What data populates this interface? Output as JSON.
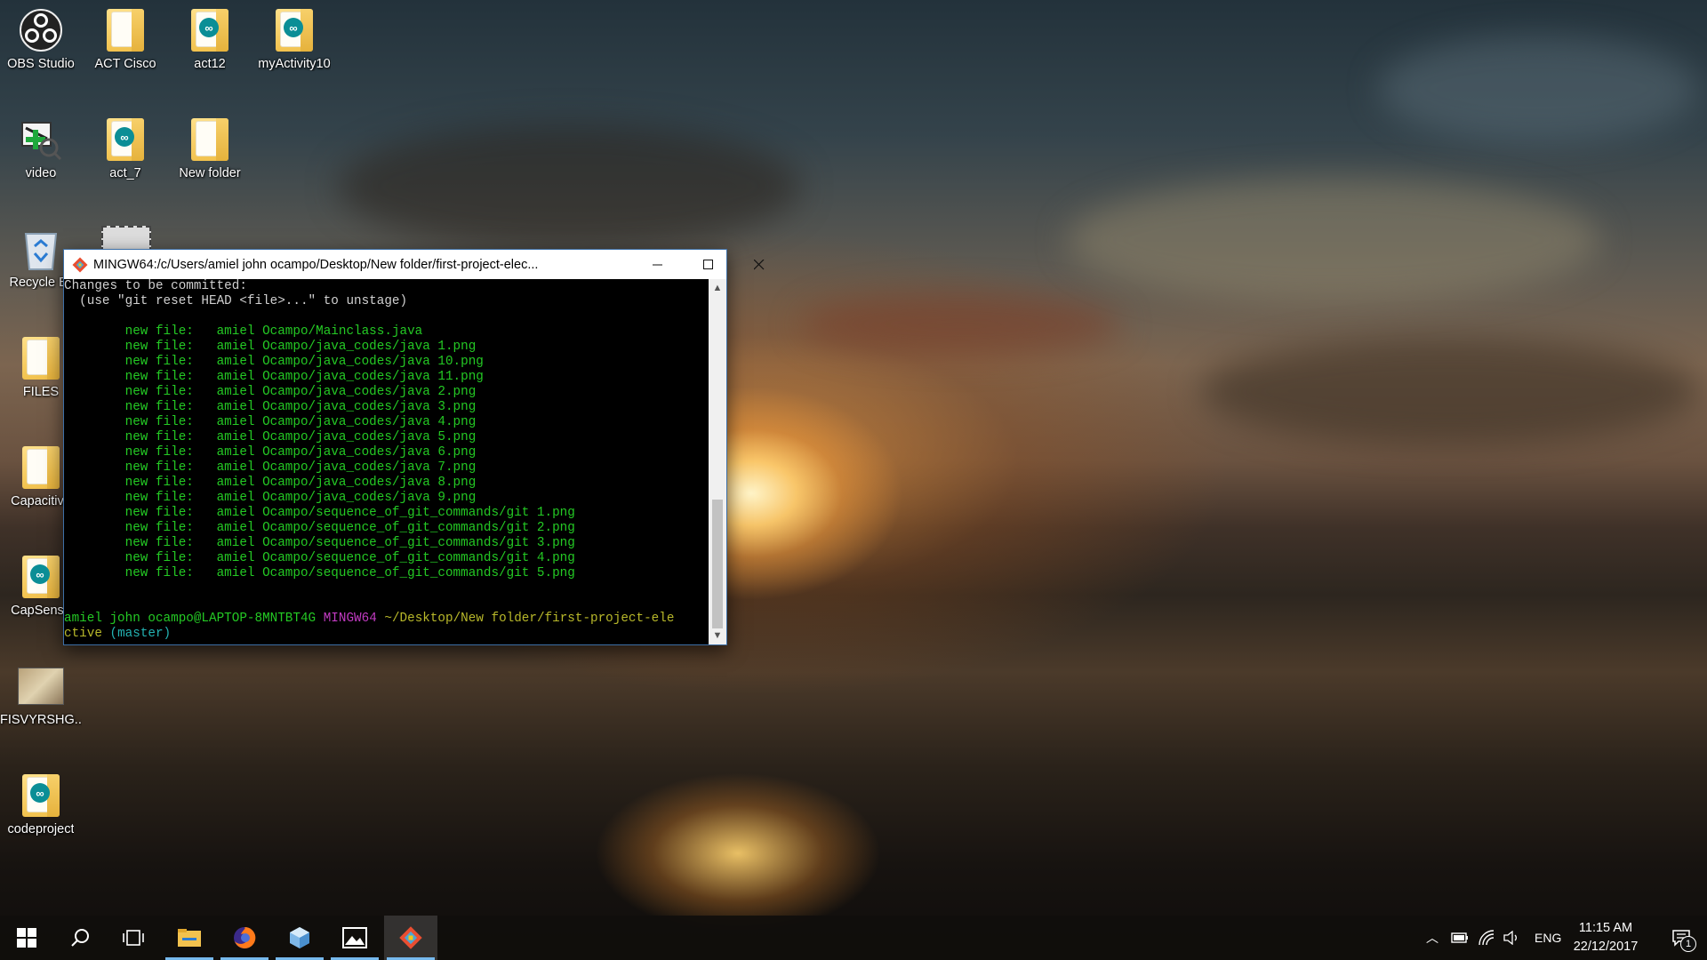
{
  "desktop": {
    "icons": [
      {
        "label": "OBS Studio",
        "icon": "obs-icon"
      },
      {
        "label": "ACT Cisco",
        "icon": "folder-icon"
      },
      {
        "label": "act12",
        "icon": "arduino-icon"
      },
      {
        "label": "myActivity10",
        "icon": "arduino-icon"
      },
      {
        "label": "video",
        "icon": "video-converter-icon"
      },
      {
        "label": "act_7",
        "icon": "arduino-icon"
      },
      {
        "label": "New folder",
        "icon": "folder-icon"
      },
      {
        "label": "Recycle Bin",
        "icon": "recycle-bin-icon"
      },
      {
        "label": "FILES",
        "icon": "folder-icon"
      },
      {
        "label": "Capacitive",
        "icon": "folder-icon"
      },
      {
        "label": "CapSense",
        "icon": "arduino-icon"
      },
      {
        "label": "FISVYRSHG...",
        "icon": "image-thumbnail-icon"
      },
      {
        "label": "codeproject",
        "icon": "arduino-icon"
      }
    ]
  },
  "terminal": {
    "title": "MINGW64:/c/Users/amiel john ocampo/Desktop/New folder/first-project-elec...",
    "lines": {
      "l1": "Changes to be committed:",
      "l2": "  (use \"git reset HEAD <file>...\" to unstage)",
      "files": [
        "        new file:   amiel Ocampo/Mainclass.java",
        "        new file:   amiel Ocampo/java_codes/java 1.png",
        "        new file:   amiel Ocampo/java_codes/java 10.png",
        "        new file:   amiel Ocampo/java_codes/java 11.png",
        "        new file:   amiel Ocampo/java_codes/java 2.png",
        "        new file:   amiel Ocampo/java_codes/java 3.png",
        "        new file:   amiel Ocampo/java_codes/java 4.png",
        "        new file:   amiel Ocampo/java_codes/java 5.png",
        "        new file:   amiel Ocampo/java_codes/java 6.png",
        "        new file:   amiel Ocampo/java_codes/java 7.png",
        "        new file:   amiel Ocampo/java_codes/java 8.png",
        "        new file:   amiel Ocampo/java_codes/java 9.png",
        "        new file:   amiel Ocampo/sequence_of_git_commands/git 1.png",
        "        new file:   amiel Ocampo/sequence_of_git_commands/git 2.png",
        "        new file:   amiel Ocampo/sequence_of_git_commands/git 3.png",
        "        new file:   amiel Ocampo/sequence_of_git_commands/git 4.png",
        "        new file:   amiel Ocampo/sequence_of_git_commands/git 5.png"
      ],
      "prompt_user": "amiel john ocampo@LAPTOP-8MNTBT4G",
      "prompt_env": "MINGW64",
      "prompt_path": "~/Desktop/New folder/first-project-ele",
      "prompt_path_cont": "ctive",
      "prompt_branch": "(master)"
    }
  },
  "taskbar": {
    "apps": [
      "start-icon",
      "search-icon",
      "task-view-icon",
      "file-explorer-icon",
      "firefox-icon",
      "3d-builder-icon",
      "photos-icon",
      "git-bash-icon"
    ],
    "tray": {
      "language": "ENG",
      "time": "11:15 AM",
      "date": "22/12/2017",
      "notifications": "1"
    }
  },
  "colors": {
    "accent": "#76b9ed",
    "terminal_green": "#24c924",
    "prompt_yellow": "#b8b82a",
    "prompt_magenta": "#c23bc2",
    "branch_cyan": "#23b2b2"
  }
}
